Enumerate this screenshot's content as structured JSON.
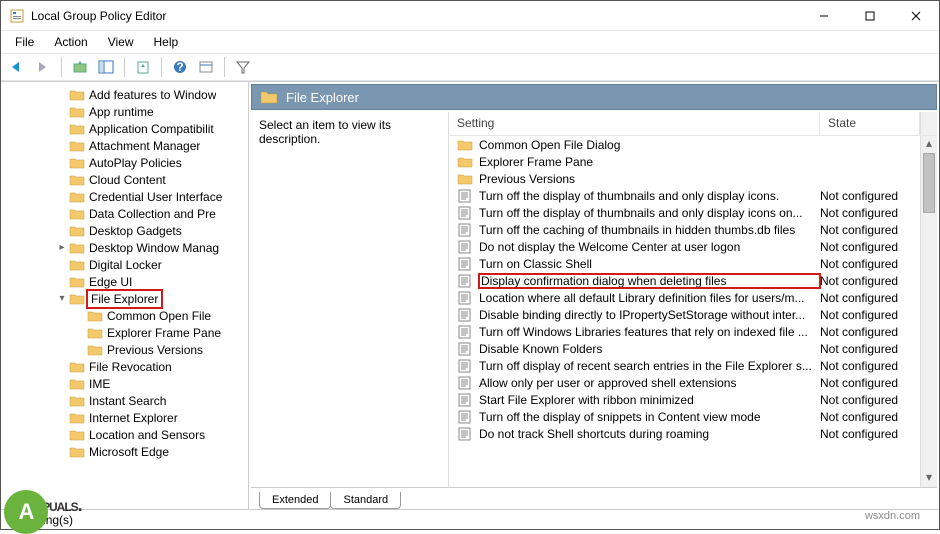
{
  "window": {
    "title": "Local Group Policy Editor"
  },
  "menu": [
    "File",
    "Action",
    "View",
    "Help"
  ],
  "tree": [
    {
      "indent": 3,
      "exp": "",
      "label": "Add features to Window"
    },
    {
      "indent": 3,
      "exp": "",
      "label": "App runtime"
    },
    {
      "indent": 3,
      "exp": "",
      "label": "Application Compatibilit"
    },
    {
      "indent": 3,
      "exp": "",
      "label": "Attachment Manager"
    },
    {
      "indent": 3,
      "exp": "",
      "label": "AutoPlay Policies"
    },
    {
      "indent": 3,
      "exp": "",
      "label": "Cloud Content"
    },
    {
      "indent": 3,
      "exp": "",
      "label": "Credential User Interface"
    },
    {
      "indent": 3,
      "exp": "",
      "label": "Data Collection and Pre"
    },
    {
      "indent": 3,
      "exp": "",
      "label": "Desktop Gadgets"
    },
    {
      "indent": 3,
      "exp": ">",
      "label": "Desktop Window Manag"
    },
    {
      "indent": 3,
      "exp": "",
      "label": "Digital Locker"
    },
    {
      "indent": 3,
      "exp": "",
      "label": "Edge UI"
    },
    {
      "indent": 3,
      "exp": "v",
      "label": "File Explorer",
      "selected": true
    },
    {
      "indent": 4,
      "exp": "",
      "label": "Common Open File"
    },
    {
      "indent": 4,
      "exp": "",
      "label": "Explorer Frame Pane"
    },
    {
      "indent": 4,
      "exp": "",
      "label": "Previous Versions"
    },
    {
      "indent": 3,
      "exp": "",
      "label": "File Revocation"
    },
    {
      "indent": 3,
      "exp": "",
      "label": "IME"
    },
    {
      "indent": 3,
      "exp": "",
      "label": "Instant Search"
    },
    {
      "indent": 3,
      "exp": "",
      "label": "Internet Explorer"
    },
    {
      "indent": 3,
      "exp": "",
      "label": "Location and Sensors"
    },
    {
      "indent": 3,
      "exp": "",
      "label": "Microsoft Edge"
    }
  ],
  "header": {
    "title": "File Explorer"
  },
  "desc": "Select an item to view its description.",
  "columns": {
    "setting": "Setting",
    "state": "State"
  },
  "rows": [
    {
      "type": "folder",
      "label": "Common Open File Dialog",
      "state": ""
    },
    {
      "type": "folder",
      "label": "Explorer Frame Pane",
      "state": ""
    },
    {
      "type": "folder",
      "label": "Previous Versions",
      "state": ""
    },
    {
      "type": "policy",
      "label": "Turn off the display of thumbnails and only display icons.",
      "state": "Not configured"
    },
    {
      "type": "policy",
      "label": "Turn off the display of thumbnails and only display icons on...",
      "state": "Not configured"
    },
    {
      "type": "policy",
      "label": "Turn off the caching of thumbnails in hidden thumbs.db files",
      "state": "Not configured"
    },
    {
      "type": "policy",
      "label": "Do not display the Welcome Center at user logon",
      "state": "Not configured"
    },
    {
      "type": "policy",
      "label": "Turn on Classic Shell",
      "state": "Not configured"
    },
    {
      "type": "policy",
      "label": "Display confirmation dialog when deleting files",
      "state": "Not configured",
      "highlight": true
    },
    {
      "type": "policy",
      "label": "Location where all default Library definition files for users/m...",
      "state": "Not configured"
    },
    {
      "type": "policy",
      "label": "Disable binding directly to IPropertySetStorage without inter...",
      "state": "Not configured"
    },
    {
      "type": "policy",
      "label": "Turn off Windows Libraries features that rely on indexed file ...",
      "state": "Not configured"
    },
    {
      "type": "policy",
      "label": "Disable Known Folders",
      "state": "Not configured"
    },
    {
      "type": "policy",
      "label": "Turn off display of recent search entries in the File Explorer s...",
      "state": "Not configured"
    },
    {
      "type": "policy",
      "label": "Allow only per user or approved shell extensions",
      "state": "Not configured"
    },
    {
      "type": "policy",
      "label": "Start File Explorer with ribbon minimized",
      "state": "Not configured"
    },
    {
      "type": "policy",
      "label": "Turn off the display of snippets in Content view mode",
      "state": "Not configured"
    },
    {
      "type": "policy",
      "label": "Do not track Shell shortcuts during roaming",
      "state": "Not configured"
    }
  ],
  "tabs": {
    "extended": "Extended",
    "standard": "Standard"
  },
  "status": "47 setting(s)",
  "watermark": "wsxdn.com",
  "logo": "PUALS"
}
